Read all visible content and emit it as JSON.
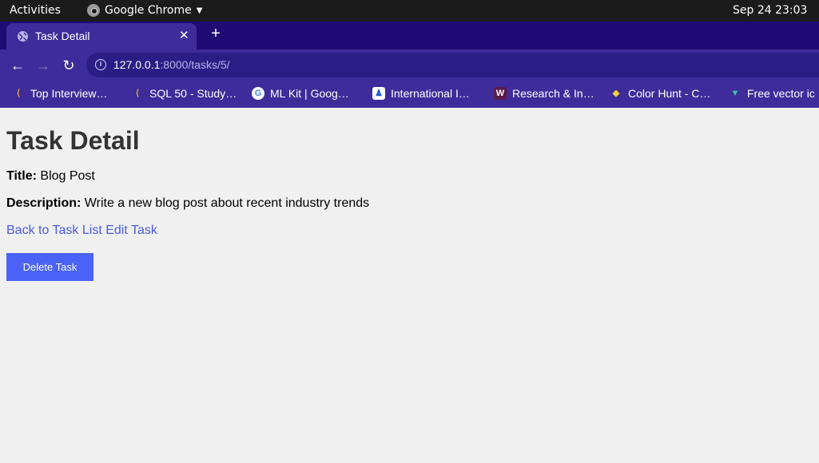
{
  "system": {
    "activities": "Activities",
    "app_name": "Google Chrome",
    "clock": "Sep 24  23:03"
  },
  "browser": {
    "tab_title": "Task Detail",
    "url_host": "127.0.0.1",
    "url_path": ":8000/tasks/5/",
    "bookmarks": [
      {
        "label": "Top Interview…",
        "icon": "leetcode-icon"
      },
      {
        "label": "SQL 50 - Study…",
        "icon": "leetcode-icon"
      },
      {
        "label": "ML Kit | Goog…",
        "icon": "google-icon"
      },
      {
        "label": "International I…",
        "icon": "intl-icon"
      },
      {
        "label": "Research & In…",
        "icon": "w-icon"
      },
      {
        "label": "Color Hunt - C…",
        "icon": "colorhunt-icon"
      },
      {
        "label": "Free vector ic",
        "icon": "freevector-icon"
      }
    ]
  },
  "page": {
    "heading": "Task Detail",
    "title_label": "Title:",
    "title_value": "Blog Post",
    "description_label": "Description:",
    "description_value": "Write a new blog post about recent industry trends",
    "back_link": "Back to Task List",
    "edit_link": "Edit Task",
    "delete_button": "Delete Task"
  }
}
